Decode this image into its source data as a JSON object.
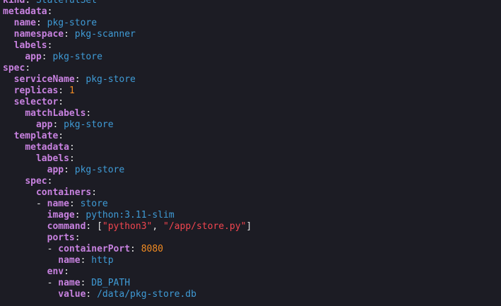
{
  "editor": {
    "lines": [
      {
        "indent": "",
        "dash": false,
        "key": "kind",
        "sep": ": ",
        "val_type": "plain",
        "value": "StatefulSet"
      },
      {
        "indent": "",
        "dash": false,
        "key": "metadata",
        "sep": ":",
        "val_type": "none",
        "value": ""
      },
      {
        "indent": "  ",
        "dash": false,
        "key": "name",
        "sep": ": ",
        "val_type": "plain",
        "value": "pkg-store"
      },
      {
        "indent": "  ",
        "dash": false,
        "key": "namespace",
        "sep": ": ",
        "val_type": "plain",
        "value": "pkg-scanner"
      },
      {
        "indent": "  ",
        "dash": false,
        "key": "labels",
        "sep": ":",
        "val_type": "none",
        "value": ""
      },
      {
        "indent": "    ",
        "dash": false,
        "key": "app",
        "sep": ": ",
        "val_type": "plain",
        "value": "pkg-store"
      },
      {
        "indent": "",
        "dash": false,
        "key": "spec",
        "sep": ":",
        "val_type": "none",
        "value": ""
      },
      {
        "indent": "  ",
        "dash": false,
        "key": "serviceName",
        "sep": ": ",
        "val_type": "plain",
        "value": "pkg-store"
      },
      {
        "indent": "  ",
        "dash": false,
        "key": "replicas",
        "sep": ": ",
        "val_type": "number",
        "value": "1"
      },
      {
        "indent": "  ",
        "dash": false,
        "key": "selector",
        "sep": ":",
        "val_type": "none",
        "value": ""
      },
      {
        "indent": "    ",
        "dash": false,
        "key": "matchLabels",
        "sep": ":",
        "val_type": "none",
        "value": ""
      },
      {
        "indent": "      ",
        "dash": false,
        "key": "app",
        "sep": ": ",
        "val_type": "plain",
        "value": "pkg-store"
      },
      {
        "indent": "  ",
        "dash": false,
        "key": "template",
        "sep": ":",
        "val_type": "none",
        "value": ""
      },
      {
        "indent": "    ",
        "dash": false,
        "key": "metadata",
        "sep": ":",
        "val_type": "none",
        "value": ""
      },
      {
        "indent": "      ",
        "dash": false,
        "key": "labels",
        "sep": ":",
        "val_type": "none",
        "value": ""
      },
      {
        "indent": "        ",
        "dash": false,
        "key": "app",
        "sep": ": ",
        "val_type": "plain",
        "value": "pkg-store"
      },
      {
        "indent": "    ",
        "dash": false,
        "key": "spec",
        "sep": ":",
        "val_type": "none",
        "value": ""
      },
      {
        "indent": "      ",
        "dash": false,
        "key": "containers",
        "sep": ":",
        "val_type": "none",
        "value": ""
      },
      {
        "indent": "      ",
        "dash": true,
        "key": "name",
        "sep": ": ",
        "val_type": "plain",
        "value": "store"
      },
      {
        "indent": "        ",
        "dash": false,
        "key": "image",
        "sep": ": ",
        "val_type": "plain",
        "value": "python:3.11-slim"
      },
      {
        "indent": "        ",
        "dash": false,
        "key": "command",
        "sep": ": ",
        "val_type": "array",
        "value": "",
        "items": [
          "\"python3\"",
          "\"/app/store.py\""
        ]
      },
      {
        "indent": "        ",
        "dash": false,
        "key": "ports",
        "sep": ":",
        "val_type": "none",
        "value": ""
      },
      {
        "indent": "        ",
        "dash": true,
        "key": "containerPort",
        "sep": ": ",
        "val_type": "number",
        "value": "8080"
      },
      {
        "indent": "          ",
        "dash": false,
        "key": "name",
        "sep": ": ",
        "val_type": "plain",
        "value": "http"
      },
      {
        "indent": "        ",
        "dash": false,
        "key": "env",
        "sep": ":",
        "val_type": "none",
        "value": ""
      },
      {
        "indent": "        ",
        "dash": true,
        "key": "name",
        "sep": ": ",
        "val_type": "plain",
        "value": "DB_PATH"
      },
      {
        "indent": "          ",
        "dash": false,
        "key": "value",
        "sep": ": ",
        "val_type": "plain",
        "value": "/data/pkg-store.db"
      }
    ]
  }
}
